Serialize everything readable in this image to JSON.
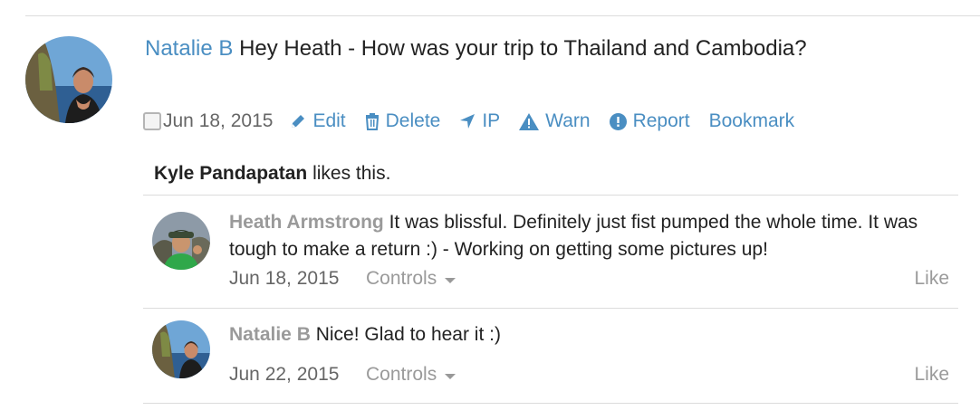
{
  "post": {
    "author": "Natalie B",
    "message": "Hey Heath - How was your trip to Thailand and Cambodia?",
    "date": "Jun 18, 2015",
    "actions": {
      "edit": "Edit",
      "delete": "Delete",
      "ip": "IP",
      "warn": "Warn",
      "report": "Report",
      "bookmark": "Bookmark"
    },
    "icons": [
      "pencil-icon",
      "trash-icon",
      "location-arrow-icon",
      "warning-icon",
      "exclamation-circle-icon"
    ],
    "likes": {
      "user": "Kyle Pandapatan",
      "suffix": "likes this."
    }
  },
  "comments": [
    {
      "author": "Heath Armstrong",
      "text": "It was blissful. Definitely just fist pumped the whole time. It was tough to make a return :) - Working on getting some pictures up!",
      "date": "Jun 18, 2015",
      "controls_label": "Controls",
      "like_label": "Like"
    },
    {
      "author": "Natalie B",
      "text": "Nice! Glad to hear it :)",
      "date": "Jun 22, 2015",
      "controls_label": "Controls",
      "like_label": "Like"
    }
  ],
  "colors": {
    "link": "#4a8ec2",
    "muted": "#9a9a9a",
    "divider": "#dcdcdc"
  }
}
